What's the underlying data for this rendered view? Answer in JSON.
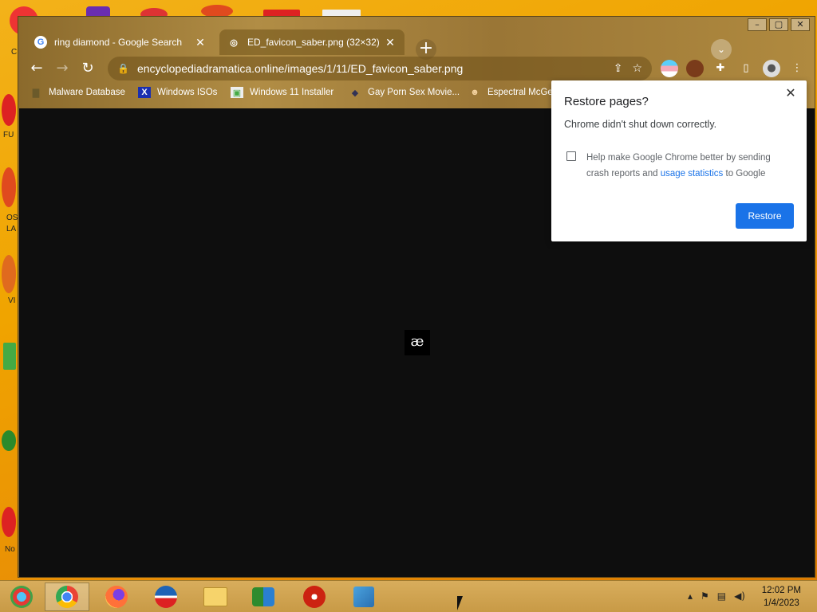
{
  "window": {
    "controls": [
      "–",
      "▢",
      "✕"
    ]
  },
  "tabs": [
    {
      "title": "ring diamond - Google Search",
      "favicon": "G",
      "close": "✕"
    },
    {
      "title": "ED_favicon_saber.png (32×32)",
      "favicon": "◎",
      "close": "✕"
    }
  ],
  "newtab_label": "+",
  "tabsearch_label": "⌄",
  "toolbar": {
    "back": "←",
    "forward": "→",
    "reload": "↻",
    "url": "encyclopediadramatica.online/images/1/11/ED_favicon_saber.png",
    "lock": "🔒"
  },
  "bookmarks": [
    {
      "label": "Malware Database",
      "icon": "▇"
    },
    {
      "label": "Windows ISOs",
      "icon": "X"
    },
    {
      "label": "Windows 11 Installer",
      "icon": "▣"
    },
    {
      "label": "Gay Porn Sex Movie...",
      "icon": "◆"
    },
    {
      "label": "Espectral McGe",
      "icon": "☻"
    }
  ],
  "viewer": {
    "image_glyph": "æ"
  },
  "dialog": {
    "title": "Restore pages?",
    "close": "✕",
    "message": "Chrome didn't shut down correctly.",
    "checkbox_text_before": "Help make Google Chrome better by sending crash reports and ",
    "checkbox_link": "usage statistics",
    "checkbox_text_after": " to Google",
    "restore_label": "Restore"
  },
  "taskbar": {
    "time": "12:02 PM",
    "date": "1/4/2023"
  },
  "desktop_labels": [
    "C",
    "FU",
    "OS",
    "LA",
    "VI",
    "No"
  ],
  "colors": {
    "accent": "#1a73e8",
    "viewport_bg": "#0e0e0e"
  }
}
